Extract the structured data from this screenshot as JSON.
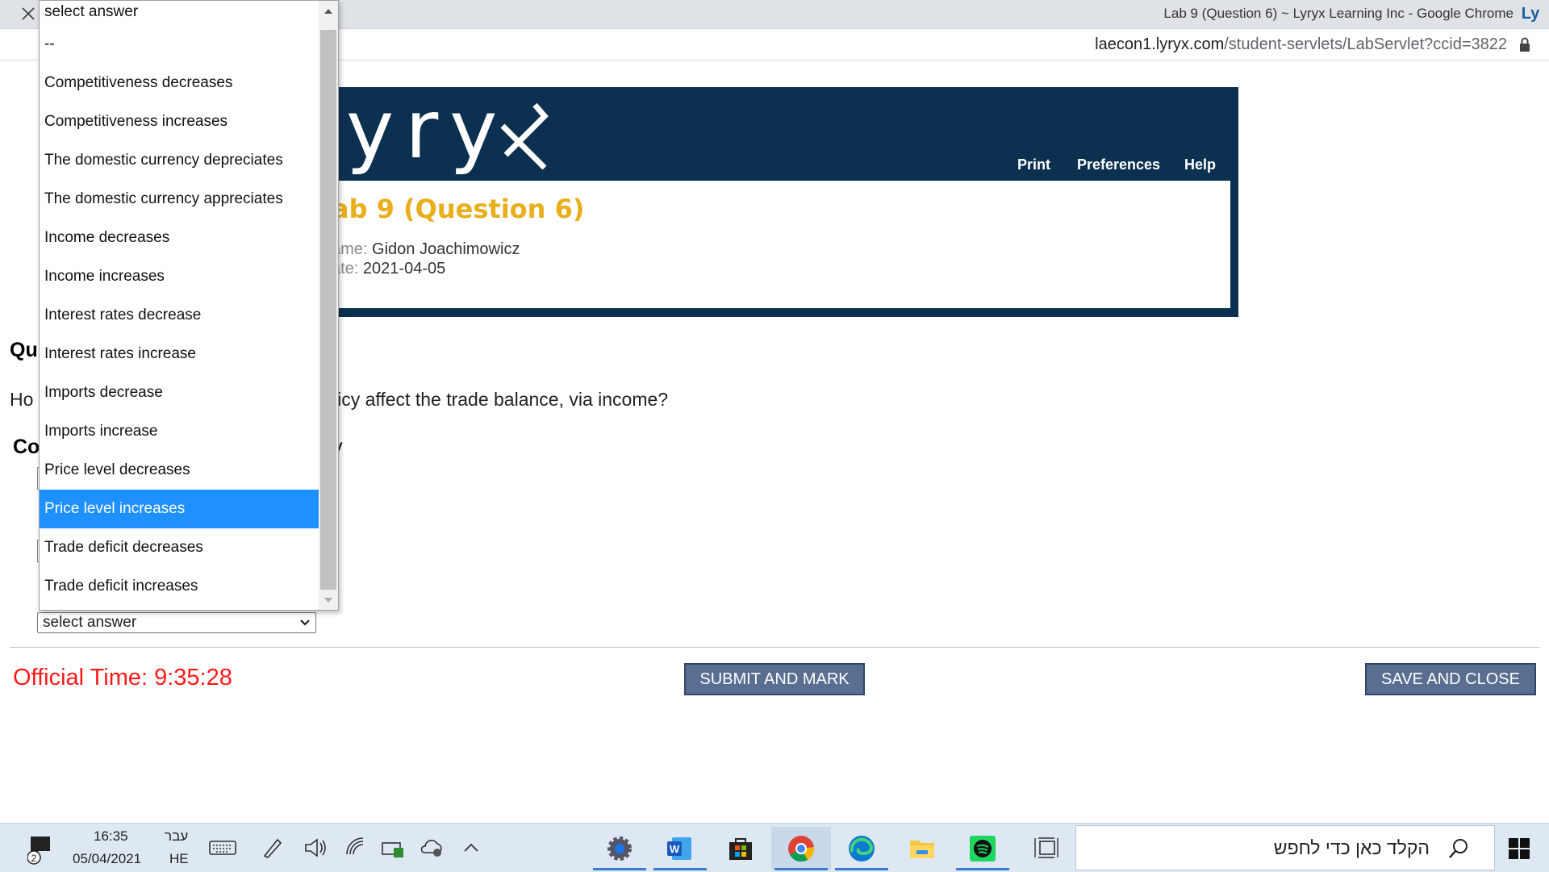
{
  "window": {
    "title": "Lab 9 (Question 6) ~ Lyryx Learning Inc - Google Chrome",
    "logo": "Ly",
    "url_host": "laecon1.lyryx.com",
    "url_path": "/student-servlets/LabServlet?ccid=3822"
  },
  "header": {
    "logo_text": "yry",
    "nav": {
      "print": "Print",
      "preferences": "Preferences",
      "help": "Help"
    },
    "lab_title": "ab 9 (Question 6)",
    "name_key": "ame:",
    "name_value": "Gidon Joachimowicz",
    "date_key": "ate:",
    "date_value": "2021-04-05"
  },
  "question": {
    "heading": "Qu",
    "text_left": "Ho",
    "text_right": "licy affect the trade balance, via income?",
    "consider_heading": "Co",
    "consider_tail": "y"
  },
  "dropdown": {
    "options": [
      "select answer",
      "--",
      "Competitiveness decreases",
      "Competitiveness increases",
      "The domestic currency depreciates",
      "The domestic currency appreciates",
      "Income decreases",
      "Income increases",
      "Interest rates decrease",
      "Interest rates increase",
      "Imports decrease",
      "Imports increase",
      "Price level decreases",
      "Price level increases",
      "Trade deficit decreases",
      "Trade deficit increases"
    ],
    "highlighted": "Price level increases"
  },
  "select": {
    "value": "select answer"
  },
  "footer": {
    "official_time": "Official Time: 9:35:28",
    "submit_label": "SUBMIT AND MARK",
    "save_label": "SAVE AND CLOSE"
  },
  "taskbar": {
    "notification_count": "2",
    "time": "16:35",
    "date": "05/04/2021",
    "lang_top": "עבר",
    "lang_bottom": "HE",
    "search_placeholder": "הקלד כאן כדי לחפש",
    "apps": [
      "settings-icon",
      "word-icon",
      "store-icon",
      "chrome-icon",
      "edge-icon",
      "file-explorer-icon",
      "spotify-icon",
      "task-view-icon"
    ]
  },
  "colors": {
    "banner": "#0c3150",
    "lab_title": "#e8ae1b",
    "highlight": "#1e90ff",
    "button": "#5a6e91",
    "time": "#ff1a1a"
  }
}
